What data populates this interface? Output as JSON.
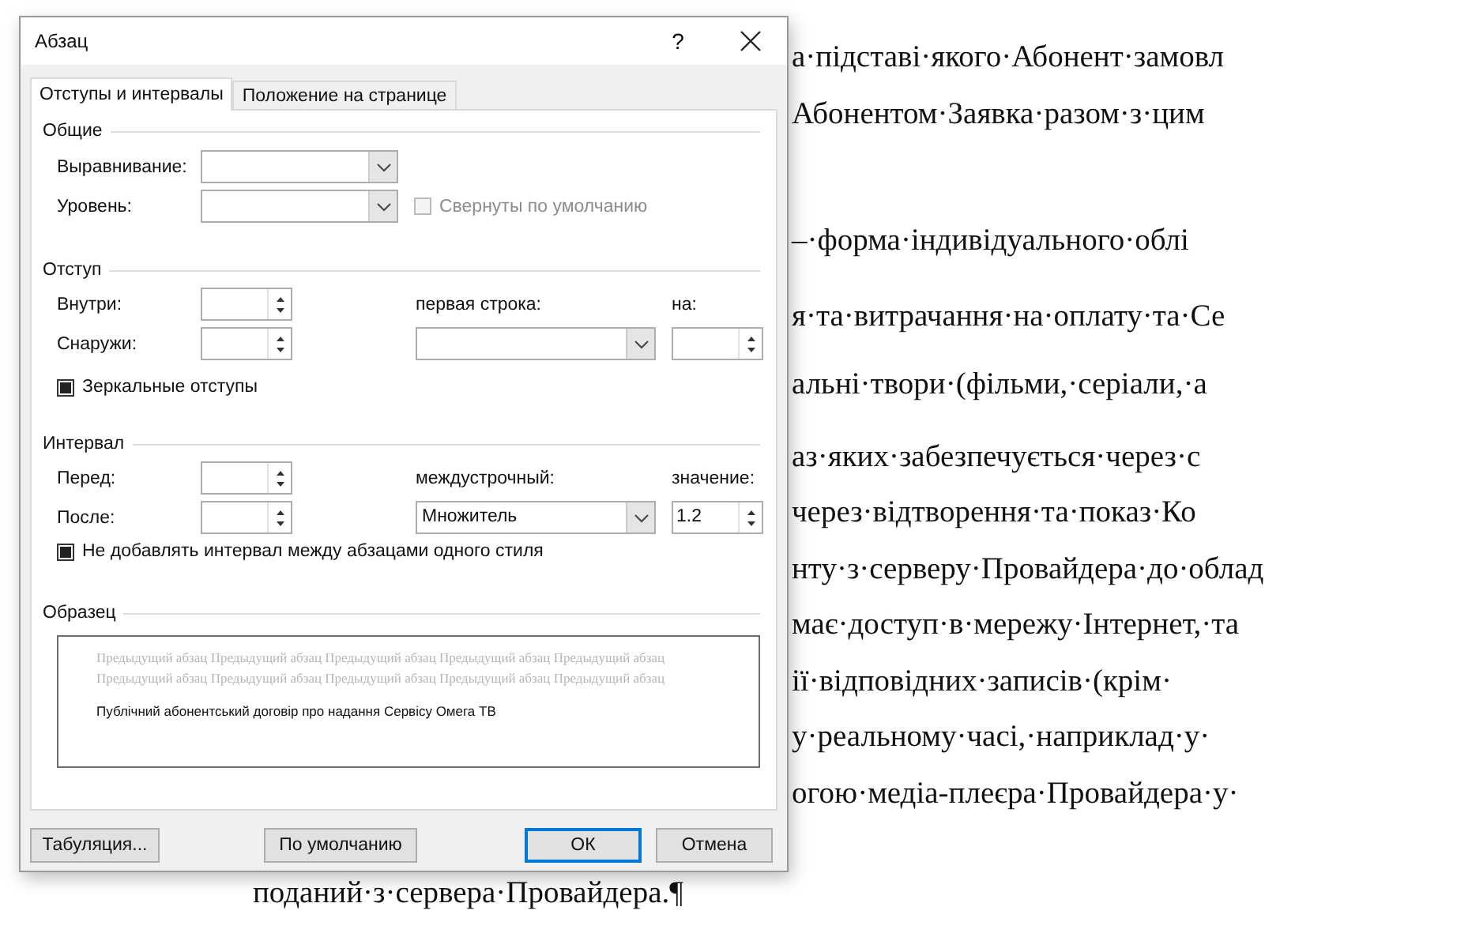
{
  "document": {
    "lines": [
      {
        "text": "а·підставі·якого·Абонент·замовл",
        "kind": "partial"
      },
      {
        "text": "Абонентом·Заявка·разом·з·цим",
        "kind": "partial"
      },
      {
        "text": "–·форма·індивідуального·облі",
        "kind": "partial"
      },
      {
        "text": "я·та·витрачання·на·оплату·та·Се",
        "kind": "partial"
      },
      {
        "text": "альні·твори·(фільми,·серіали,·а",
        "kind": "partial"
      },
      {
        "text": "аз·яких·забезпечується·через·с",
        "kind": "partial"
      },
      {
        "text": "через·відтворення·та·показ·Ко",
        "kind": "partial"
      },
      {
        "text": "нту·з·серверу·Провайдера·до·облад",
        "kind": "partial"
      },
      {
        "text": "має·доступ·в·мережу·Інтернет,·та",
        "kind": "partial"
      },
      {
        "text": "ії·відповідних·записів·(крім·",
        "kind": "partial"
      },
      {
        "text": "у·реальному·часі,·наприклад·у·",
        "kind": "partial"
      },
      {
        "text": "огою·медіа-плеєра·Провайдера·у·",
        "kind": "partial"
      },
      {
        "text": "поданий·з·сервера·Провайдера.¶",
        "kind": "full"
      }
    ]
  },
  "dialog": {
    "title": "Абзац",
    "help": "?",
    "tabs": [
      {
        "label": "Отступы и интервалы",
        "selected": true
      },
      {
        "label": "Положение на странице",
        "selected": false
      }
    ],
    "general": {
      "heading": "Общие",
      "alignment_label": "Выравнивание:",
      "level_label": "Уровень:",
      "collapsed": {
        "label": "Свернуты по умолчанию",
        "checked": false,
        "disabled": true
      }
    },
    "indent": {
      "heading": "Отступ",
      "inside_label": "Внутри:",
      "outside_label": "Снаружи:",
      "first_line_label": "первая строка:",
      "by_label": "на:",
      "mirror": {
        "label": "Зеркальные отступы",
        "checked": true,
        "disabled": false
      }
    },
    "spacing": {
      "heading": "Интервал",
      "before_label": "Перед:",
      "after_label": "После:",
      "line_label": "междустрочный:",
      "line_value": "Множитель",
      "at_label": "значение:",
      "at_value": "1.2",
      "dont_add": {
        "label": "Не добавлять интервал между абзацами одного стиля",
        "checked": true,
        "disabled": false
      }
    },
    "preview": {
      "heading": "Образец",
      "previous": "Предыдущий абзац Предыдущий абзац Предыдущий абзац Предыдущий абзац Предыдущий абзац Предыдущий абзац Предыдущий абзац Предыдущий абзац Предыдущий абзац Предыдущий абзац",
      "current": "Публічний абонентський договір про надання Сервісу Омега ТВ"
    },
    "buttons": [
      {
        "label": "Табуляция...",
        "default": false
      },
      {
        "label": "По умолчанию",
        "default": false
      },
      {
        "label": "ОК",
        "default": true
      },
      {
        "label": "Отмена",
        "default": false
      }
    ]
  }
}
